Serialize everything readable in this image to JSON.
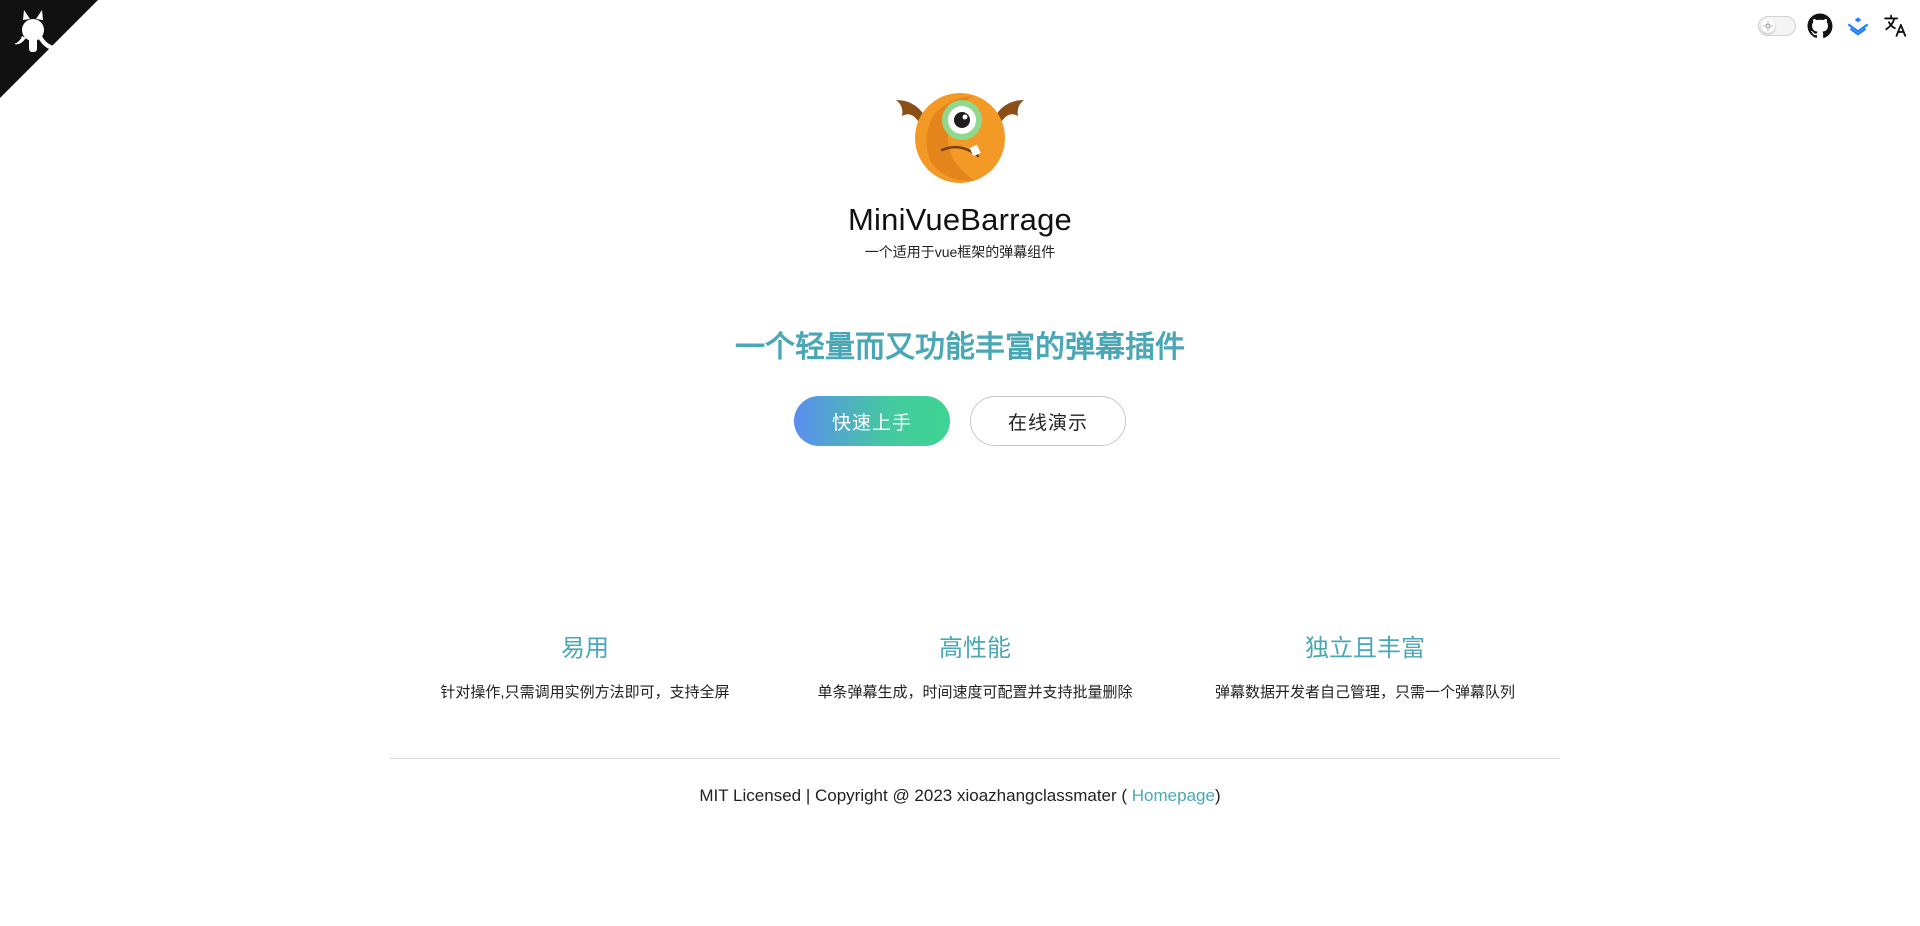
{
  "icons": {
    "corner": "github-octocat-icon",
    "theme_toggle": "sun-icon",
    "github": "github-icon",
    "stack": "layers-icon",
    "translate": "translate-icon",
    "logo": "orange-monster-logo"
  },
  "colors": {
    "accent": "#4aa8b6",
    "button_gradient_start": "#5b8def",
    "button_gradient_end": "#3dd492"
  },
  "hero": {
    "title": "MiniVueBarrage",
    "description": "一个适用于vue框架的弹幕组件",
    "tagline": "一个轻量而又功能丰富的弹幕插件",
    "primary_button": "快速上手",
    "secondary_button": "在线演示"
  },
  "features": [
    {
      "title": "易用",
      "details": "针对操作,只需调用实例方法即可，支持全屏"
    },
    {
      "title": "高性能",
      "details": "单条弹幕生成，时间速度可配置并支持批量删除"
    },
    {
      "title": "独立且丰富",
      "details": "弹幕数据开发者自己管理，只需一个弹幕队列"
    }
  ],
  "footer": {
    "text": "MIT Licensed | Copyright @ 2023 xioazhangclassmater ( ",
    "link_label": "Homepage",
    "suffix": ")"
  }
}
